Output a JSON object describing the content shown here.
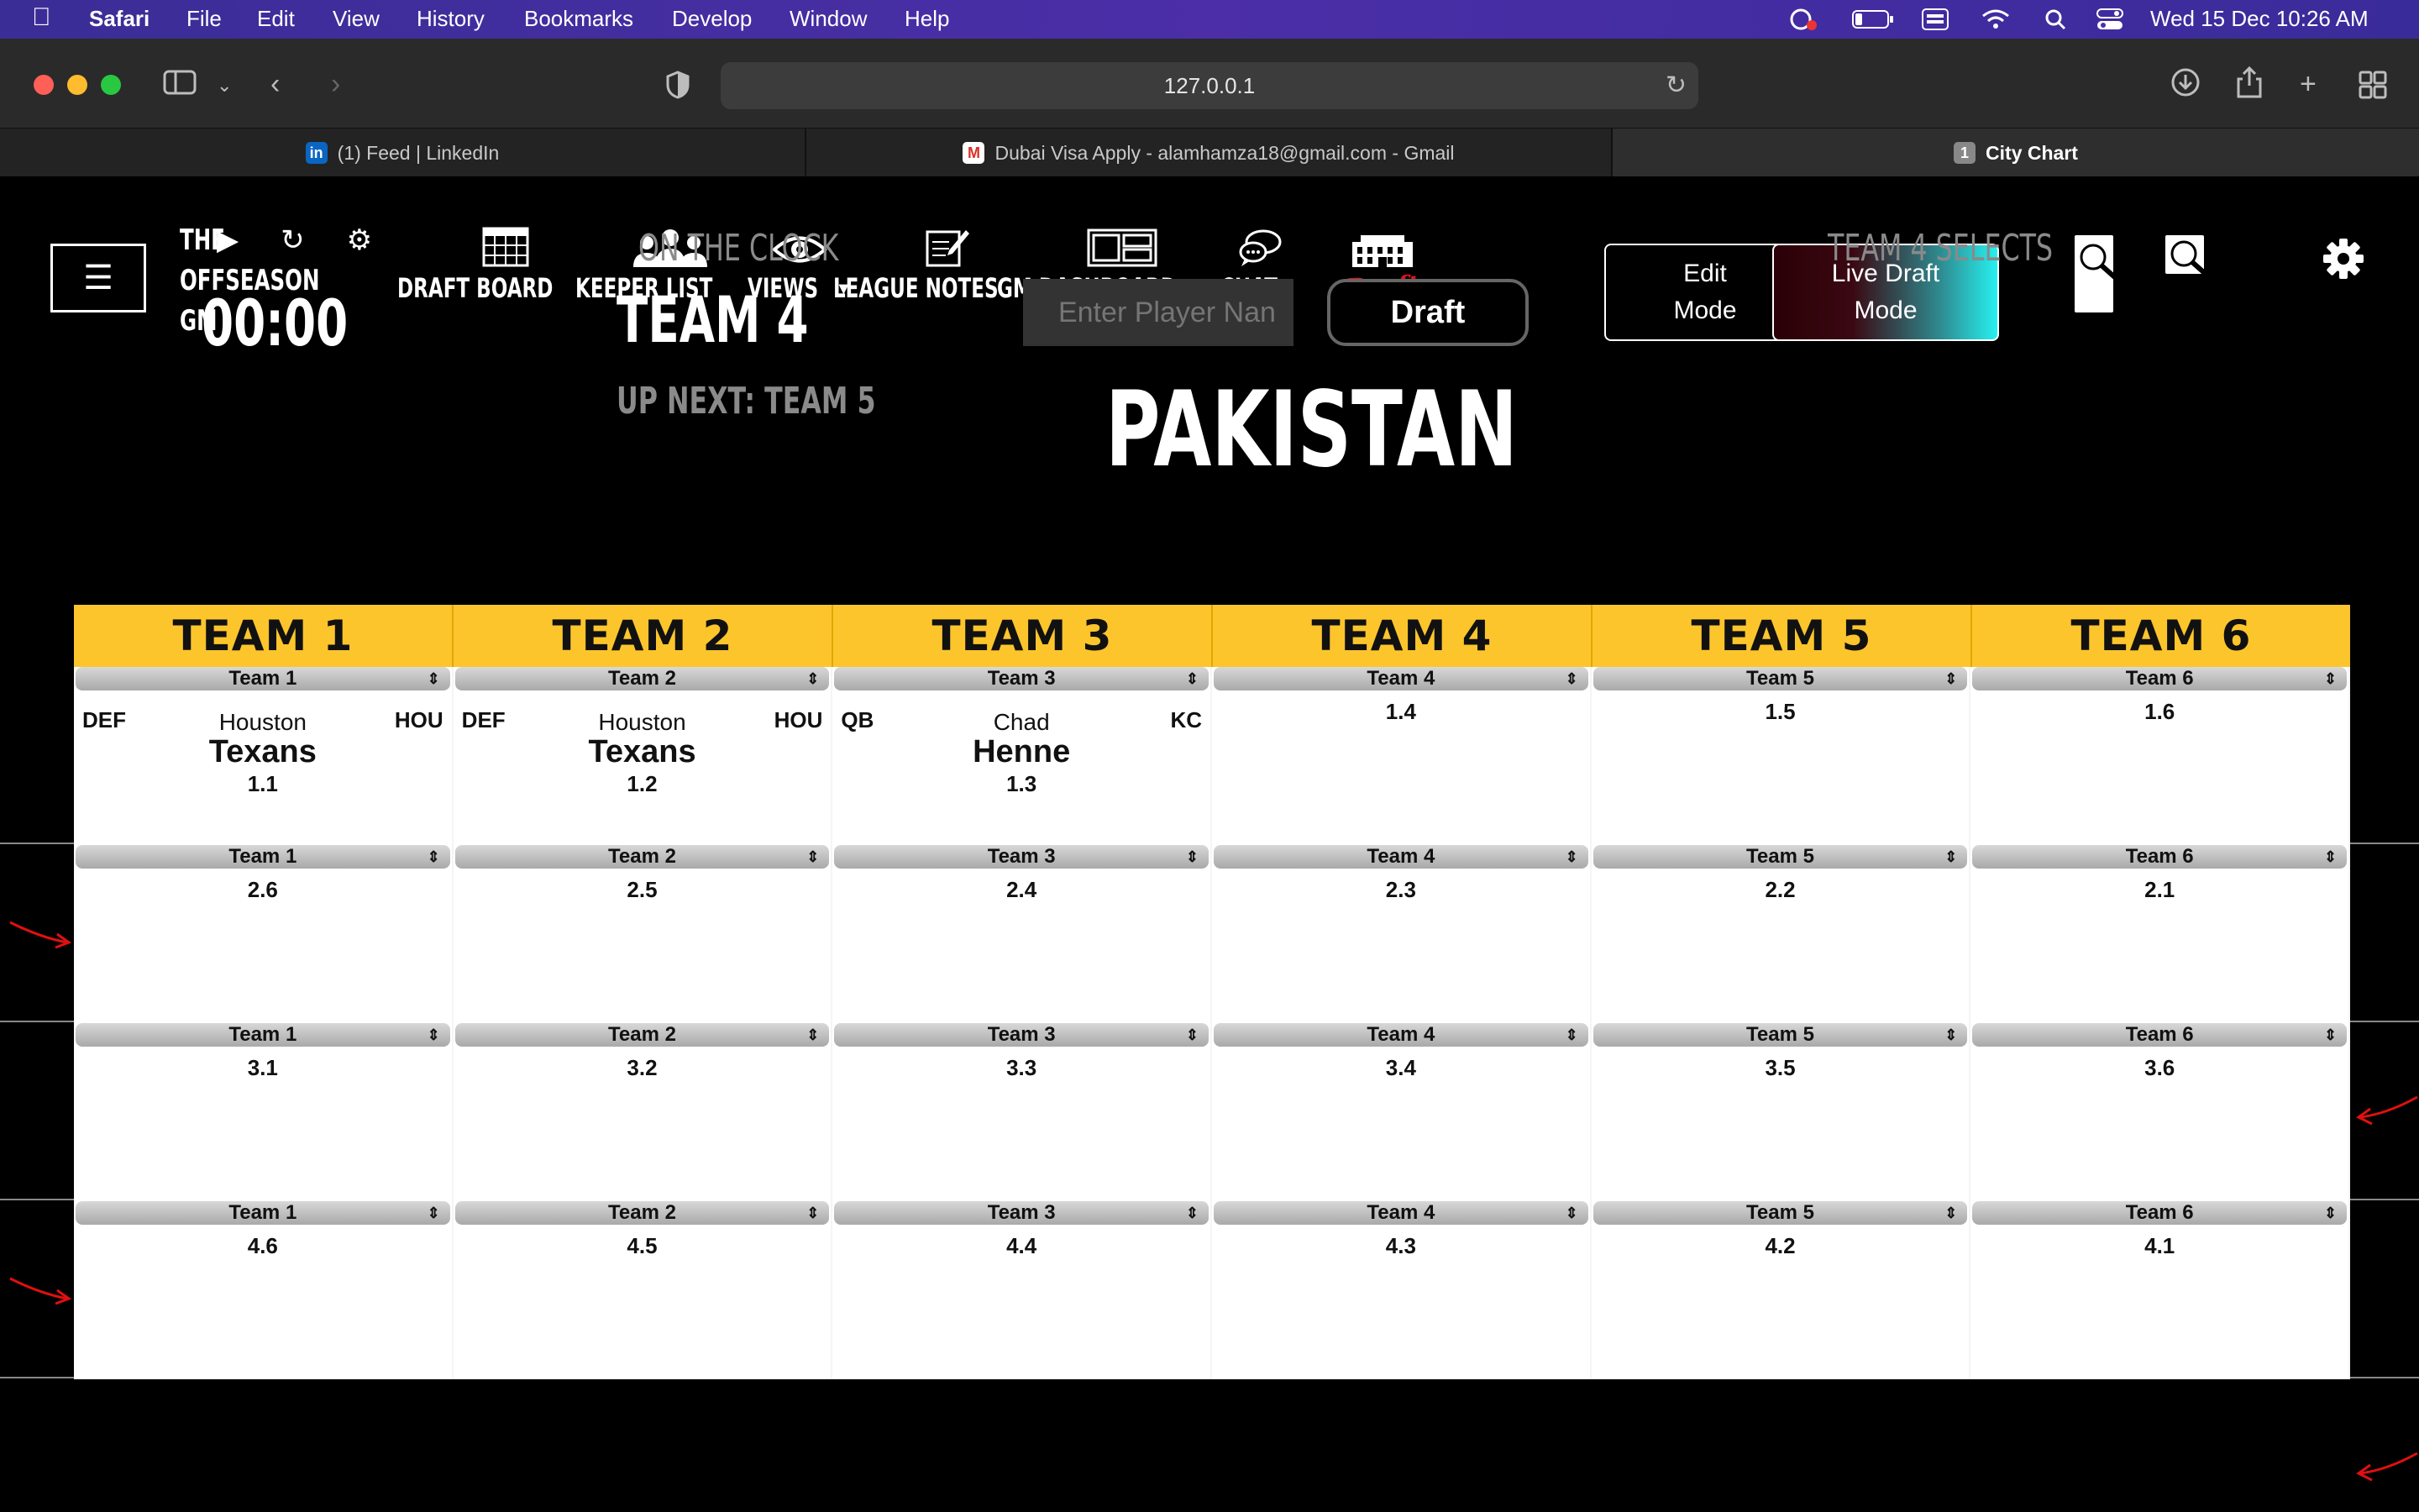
{
  "menubar": {
    "app": "Safari",
    "items": [
      "File",
      "Edit",
      "View",
      "History",
      "Bookmarks",
      "Develop",
      "Window",
      "Help"
    ],
    "clock": "Wed 15 Dec  10:26 AM"
  },
  "browser": {
    "url": "127.0.0.1",
    "tabs": [
      {
        "title": "(1) Feed | LinkedIn",
        "favicon": "linkedin-icon"
      },
      {
        "title": "Dubai Visa Apply - alamhamza18@gmail.com - Gmail",
        "favicon": "gmail-icon"
      },
      {
        "title": "City Chart",
        "favicon": "1"
      }
    ]
  },
  "app": {
    "logo_lines": [
      "THE",
      "OFFSEASON",
      "GM"
    ],
    "nav": [
      {
        "label": "DRAFT BOARD",
        "icon": "calendar-grid-icon"
      },
      {
        "label": "KEEPER LIST",
        "icon": "people-group-icon"
      },
      {
        "label": "VIEWS",
        "icon": "eye-icon"
      },
      {
        "label": "LEAGUE NOTES",
        "icon": "notepad-icon"
      },
      {
        "label": "GM DASHBOARD",
        "icon": "dashboard-icon"
      },
      {
        "label": "CHAT",
        "icon": "chat-bubbles-icon"
      },
      {
        "label": "Draft Room",
        "icon": "building-icon"
      }
    ],
    "edit_mode": [
      "Edit",
      "Mode"
    ],
    "live_draft_mode": [
      "Live Draft",
      "Mode"
    ]
  },
  "draft": {
    "timer": "00:00",
    "on_the_clock_label": "ON THE CLOCK",
    "on_the_clock_team": "TEAM 4",
    "up_next": "UP NEXT: TEAM 5",
    "input_placeholder": "Enter Player Nan",
    "draft_button": "Draft",
    "selected_name": "PAKISTAN",
    "selects_label": "TEAM 4 SELECTS"
  },
  "board": {
    "teams": [
      "TEAM 1",
      "TEAM 2",
      "TEAM 3",
      "TEAM 4",
      "TEAM 5",
      "TEAM 6"
    ],
    "rounds": [
      {
        "cells": [
          {
            "owner": "Team 1",
            "pick": "1.1",
            "pos": "DEF",
            "first": "Houston",
            "last": "Texans",
            "abbr": "HOU"
          },
          {
            "owner": "Team 2",
            "pick": "1.2",
            "pos": "DEF",
            "first": "Houston",
            "last": "Texans",
            "abbr": "HOU"
          },
          {
            "owner": "Team 3",
            "pick": "1.3",
            "pos": "QB",
            "first": "Chad",
            "last": "Henne",
            "abbr": "KC"
          },
          {
            "owner": "Team 4",
            "pick": "1.4"
          },
          {
            "owner": "Team 5",
            "pick": "1.5"
          },
          {
            "owner": "Team 6",
            "pick": "1.6"
          }
        ]
      },
      {
        "cells": [
          {
            "owner": "Team 1",
            "pick": "2.6"
          },
          {
            "owner": "Team 2",
            "pick": "2.5"
          },
          {
            "owner": "Team 3",
            "pick": "2.4"
          },
          {
            "owner": "Team 4",
            "pick": "2.3"
          },
          {
            "owner": "Team 5",
            "pick": "2.2"
          },
          {
            "owner": "Team 6",
            "pick": "2.1"
          }
        ]
      },
      {
        "cells": [
          {
            "owner": "Team 1",
            "pick": "3.1"
          },
          {
            "owner": "Team 2",
            "pick": "3.2"
          },
          {
            "owner": "Team 3",
            "pick": "3.3"
          },
          {
            "owner": "Team 4",
            "pick": "3.4"
          },
          {
            "owner": "Team 5",
            "pick": "3.5"
          },
          {
            "owner": "Team 6",
            "pick": "3.6"
          }
        ]
      },
      {
        "cells": [
          {
            "owner": "Team 1",
            "pick": "4.6"
          },
          {
            "owner": "Team 2",
            "pick": "4.5"
          },
          {
            "owner": "Team 3",
            "pick": "4.4"
          },
          {
            "owner": "Team 4",
            "pick": "4.3"
          },
          {
            "owner": "Team 5",
            "pick": "4.2"
          },
          {
            "owner": "Team 6",
            "pick": "4.1"
          }
        ]
      }
    ]
  },
  "colors": {
    "accent_yellow": "#fcc52c",
    "snake_arrow": "#e01010",
    "menubar": "#4b2ea8"
  }
}
